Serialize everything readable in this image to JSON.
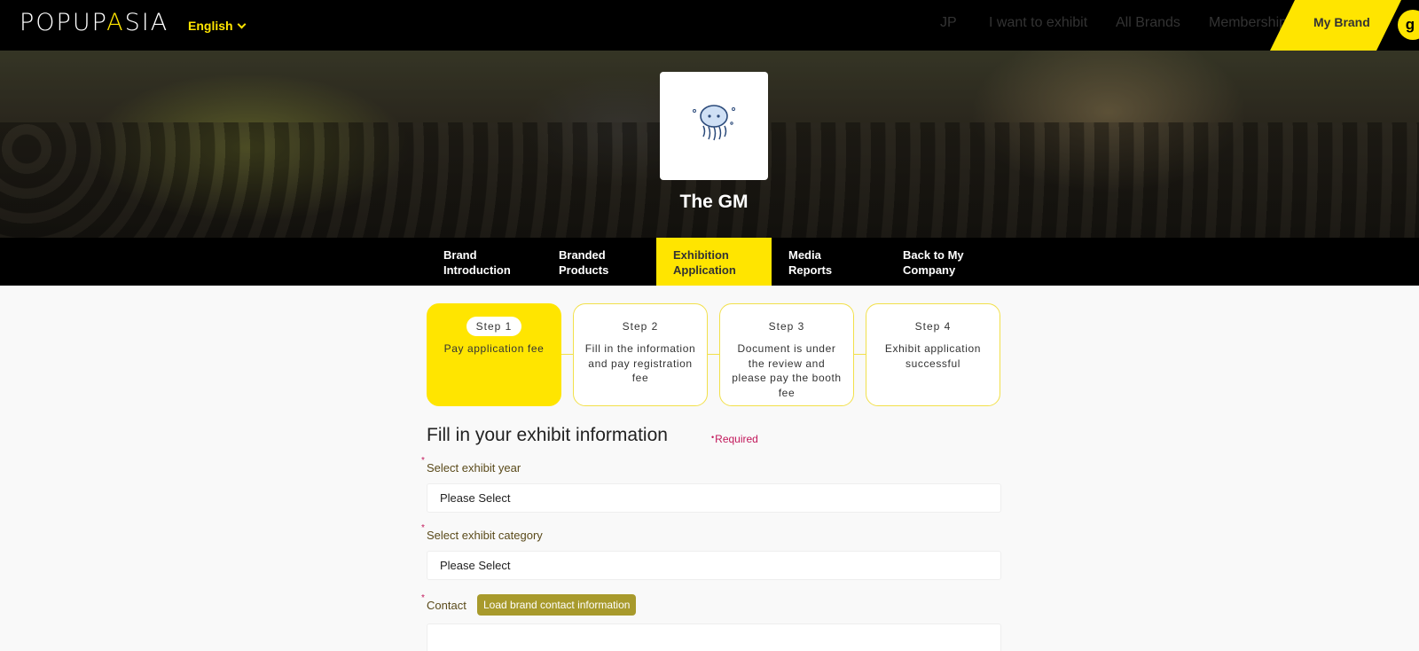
{
  "header": {
    "logo_part1": "POPUP",
    "logo_part2": "A",
    "logo_part3": "SIA",
    "language": "English",
    "nav": {
      "jp": "JP",
      "exhibit": "I want to exhibit",
      "brands": "All Brands",
      "membership": "Membership",
      "my_brand": "My Brand"
    },
    "avatar_initial": "g"
  },
  "hero": {
    "brand_name": "The GM",
    "logo_icon": "jellyfish-icon"
  },
  "tabs": [
    {
      "line1": "Brand",
      "line2": "Introduction"
    },
    {
      "line1": "Branded",
      "line2": "Products"
    },
    {
      "line1": "Exhibition",
      "line2": "Application"
    },
    {
      "line1": "Media",
      "line2": "Reports"
    },
    {
      "line1": "Back to My",
      "line2": "Company"
    }
  ],
  "active_tab": 2,
  "steps": [
    {
      "label": "Step 1",
      "desc": "Pay application fee"
    },
    {
      "label": "Step 2",
      "desc": "Fill in the information and pay registration fee"
    },
    {
      "label": "Step 3",
      "desc": "Document is under the review and please pay the booth fee"
    },
    {
      "label": "Step 4",
      "desc": "Exhibit application successful"
    }
  ],
  "active_step": 0,
  "form": {
    "title": "Fill in your exhibit information",
    "required_note": "Required",
    "year_label": "Select exhibit year",
    "year_value": "Please Select",
    "category_label": "Select exhibit category",
    "category_value": "Please Select",
    "contact_label": "Contact",
    "load_button": "Load brand contact information"
  },
  "colors": {
    "accent": "#ffe500",
    "button": "#a89a2c",
    "required": "#c2185b"
  }
}
